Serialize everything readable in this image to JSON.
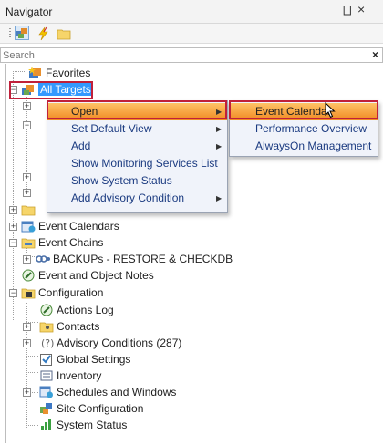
{
  "panel": {
    "title": "Navigator",
    "pin_glyph": "⨆",
    "close_glyph": "×"
  },
  "toolbar": {
    "icons": [
      "targets-icon",
      "lightning-icon",
      "folder-icon"
    ]
  },
  "search": {
    "placeholder": "Search",
    "clear_glyph": "×"
  },
  "tree": {
    "favorites": "Favorites",
    "all_targets": "All Targets",
    "event_calendars": "Event Calendars",
    "event_chains": "Event Chains",
    "backups": "BACKUPs - RESTORE & CHECKDB",
    "event_notes": "Event and Object Notes",
    "configuration": "Configuration",
    "config_children": [
      "Actions Log",
      "Contacts",
      "Advisory Conditions (287)",
      "Global Settings",
      "Inventory",
      "Schedules and Windows",
      "Site Configuration",
      "System Status"
    ]
  },
  "context_menu": {
    "items": [
      "Open",
      "Set Default View",
      "Add",
      "Show Monitoring Services List",
      "Show System Status",
      "Add Advisory Condition"
    ],
    "active": "Open"
  },
  "submenu": {
    "items": [
      "Event Calendar",
      "Performance Overview",
      "AlwaysOn Management"
    ],
    "active": "Event Calendar"
  },
  "colors": {
    "selection": "#3399ff",
    "menu_text": "#1a3a80",
    "highlight_border": "#c0203a",
    "active_gradient_top": "#ffc266",
    "active_gradient_bottom": "#f08a22"
  }
}
